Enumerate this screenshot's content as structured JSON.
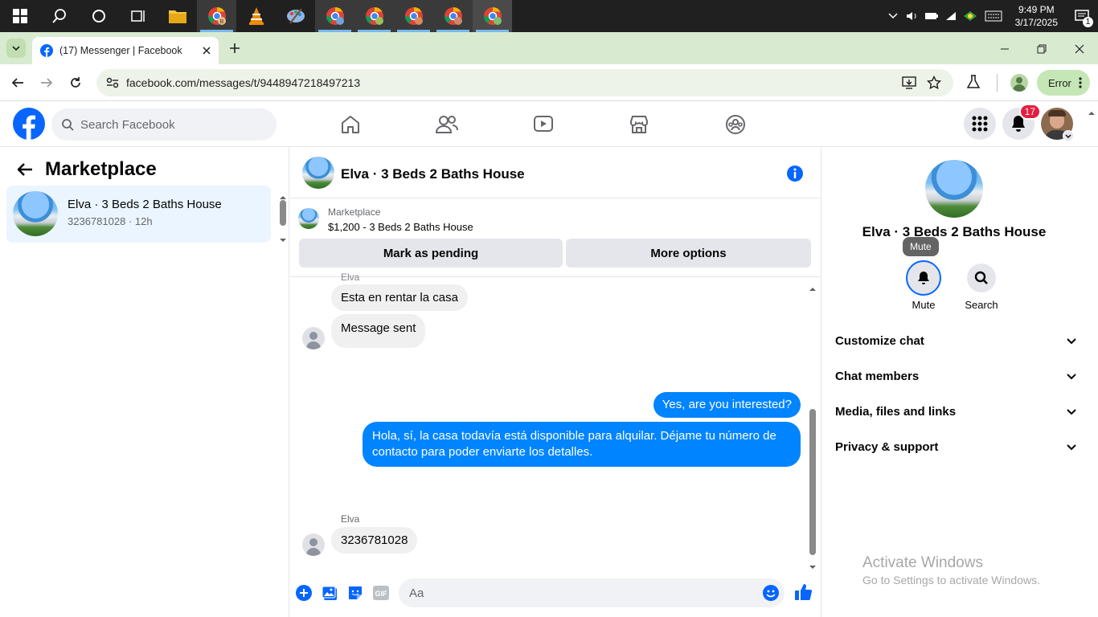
{
  "taskbar": {
    "apps": [
      "windows-start",
      "search",
      "cortana",
      "task-view",
      "file-explorer",
      "chrome-profile-b",
      "vlc",
      "paint",
      "chrome-1",
      "chrome-2",
      "chrome-3",
      "chrome-4",
      "chrome-5"
    ],
    "clock_time": "9:49 PM",
    "clock_date": "3/17/2025",
    "notification_count": "1"
  },
  "browser": {
    "tab_title": "(17) Messenger | Facebook",
    "url": "facebook.com/messages/t/9448947218497213",
    "error_label": "Error"
  },
  "fb": {
    "search_placeholder": "Search Facebook",
    "notifications_badge": "17"
  },
  "sidebar": {
    "title": "Marketplace",
    "conversations": [
      {
        "name": "Elva · 3 Beds 2 Baths House",
        "phone": "3236781028",
        "time": "12h"
      }
    ]
  },
  "chat": {
    "title": "Elva · 3 Beds 2 Baths House",
    "marketplace_label": "Marketplace",
    "listing": "$1,200 - 3 Beds 2 Baths House",
    "mark_pending": "Mark as pending",
    "more_options": "More options",
    "messages": {
      "sender_top": "Elva",
      "in1": "Esta en rentar la casa",
      "in2": "Message sent",
      "out1": "Yes, are you interested?",
      "out2": "Hola, sí, la casa todavía está disponible para alquilar. Déjame tu número de contacto para poder enviarte los detalles.",
      "sender_bottom": "Elva",
      "in3": "3236781028"
    },
    "composer_placeholder": "Aa"
  },
  "right_panel": {
    "title": "Elva · 3 Beds 2 Baths House",
    "tooltip": "Mute",
    "mute_label": "Mute",
    "search_label": "Search",
    "sections": [
      "Customize chat",
      "Chat members",
      "Media, files and links",
      "Privacy & support"
    ]
  },
  "watermark": {
    "line1": "Activate Windows",
    "line2": "Go to Settings to activate Windows."
  },
  "colors": {
    "fb_blue": "#0866ff",
    "messenger_blue": "#0084ff",
    "badge_red": "#e41e3f",
    "chrome_green": "#d8ebd0"
  }
}
